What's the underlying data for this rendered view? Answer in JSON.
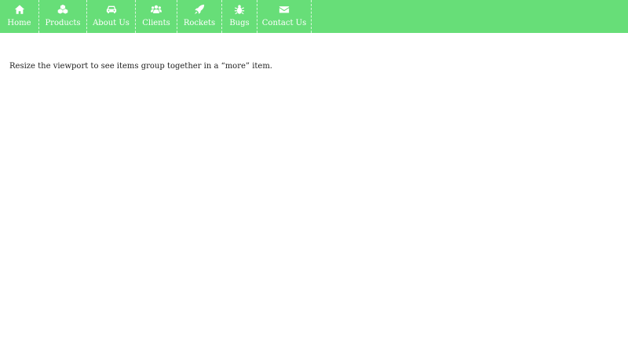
{
  "navbar": {
    "background": "#67de78",
    "items": [
      {
        "label": "Home",
        "icon": "home-icon"
      },
      {
        "label": "Products",
        "icon": "cubes-icon"
      },
      {
        "label": "About Us",
        "icon": "car-icon"
      },
      {
        "label": "Clients",
        "icon": "users-icon"
      },
      {
        "label": "Rockets",
        "icon": "rocket-icon"
      },
      {
        "label": "Bugs",
        "icon": "bug-icon"
      },
      {
        "label": "Contact Us",
        "icon": "envelope-icon"
      }
    ]
  },
  "main": {
    "message": "Resize the viewport to see items group together in a “more” item."
  }
}
